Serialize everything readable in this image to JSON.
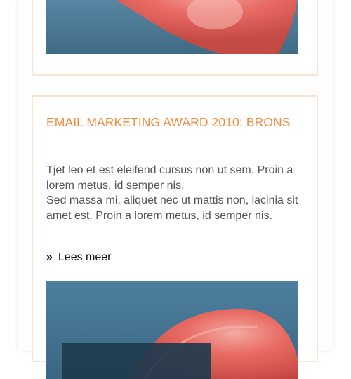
{
  "article": {
    "headline": "EMAIL MARKETING AWARD 2010: BRONS",
    "paragraph_1": "Tjet leo et est eleifend cursus non ut sem. Proin a lorem metus, id semper nis.",
    "paragraph_2": "Sed massa mi, aliquet nec ut mattis non, lacinia sit amet est. Proin a lorem metus, id semper nis.",
    "read_more_chevron": "»",
    "read_more_label": "Lees meer"
  },
  "colors": {
    "accent": "#f28a3d",
    "card_border": "#fbe4d2",
    "body_text": "#555555",
    "photo_background": "#4f7a96",
    "petal": "#e6645f"
  }
}
